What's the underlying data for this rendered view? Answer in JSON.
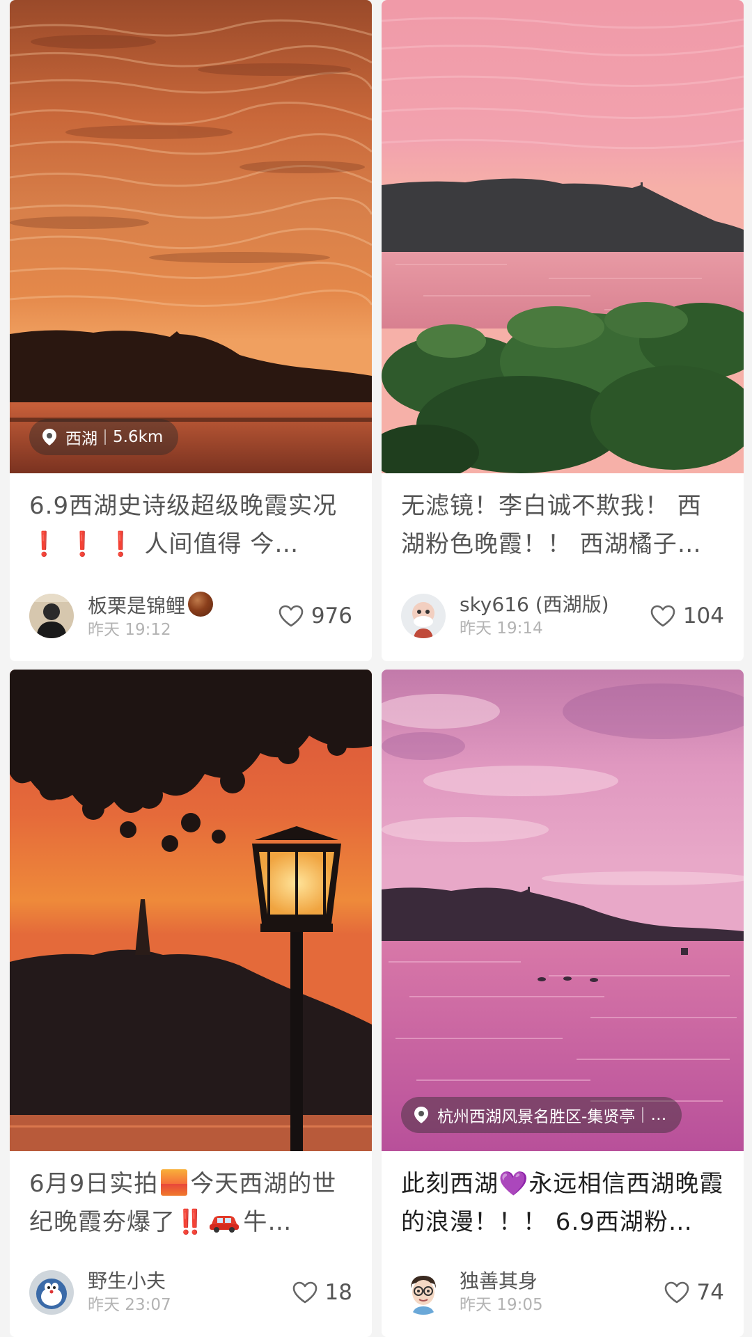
{
  "colors": {
    "background": "#f4f4f4",
    "card": "#ffffff",
    "title_text": "#555555",
    "meta_text": "#b3b3b3",
    "exclamation_red": "#e2261c",
    "purple_heart": "#9b4dff"
  },
  "posts": [
    {
      "image_description_icon": "sunset-orange-clouds-west-lake",
      "location_tag": {
        "icon": "location-pin-icon",
        "place": "西湖",
        "distance": "5.6km"
      },
      "title_parts": [
        "6.9西湖史诗级超级晚霞实况",
        "❗",
        "❗",
        "❗",
        "人间值得 今…"
      ],
      "author": {
        "name": "板栗是锦鲤",
        "name_emoji": "chestnut-emoji",
        "avatar_icon": "avatar-silhouette"
      },
      "time": "昨天 19:12",
      "likes": "976"
    },
    {
      "image_description_icon": "pink-sky-lotus-leaves",
      "title_parts": [
        "无滤镜！李白诚不欺我！ 西湖粉色晚霞！！ 西湖橘子…"
      ],
      "author": {
        "name": "sky616 (西湖版)",
        "avatar_icon": "avatar-cartoon-grandpa"
      },
      "time": "昨天 19:14",
      "likes": "104"
    },
    {
      "image_description_icon": "orange-sunset-pagoda-street-lamp",
      "title_parts": [
        "6月9日实拍",
        "sunrise-emoji",
        "今天西湖的世纪晚霞夯爆了",
        "‼️",
        "car-emoji",
        "牛…"
      ],
      "author": {
        "name": "野生小夫",
        "avatar_icon": "avatar-doraemon-like"
      },
      "time": "昨天 23:07",
      "likes": "18"
    },
    {
      "image_description_icon": "pink-purple-sky-lake-ducks",
      "location_tag": {
        "icon": "location-pin-icon",
        "place": "杭州西湖风景名胜区-集贤亭",
        "distance": "…"
      },
      "title_parts": [
        "此刻西湖",
        "💜",
        "永远相信西湖晚霞的浪漫！！！ 6.9西湖粉…"
      ],
      "author": {
        "name": "独善其身",
        "avatar_icon": "avatar-cartoon-glasses"
      },
      "time": "昨天 19:05",
      "likes": "74"
    }
  ]
}
